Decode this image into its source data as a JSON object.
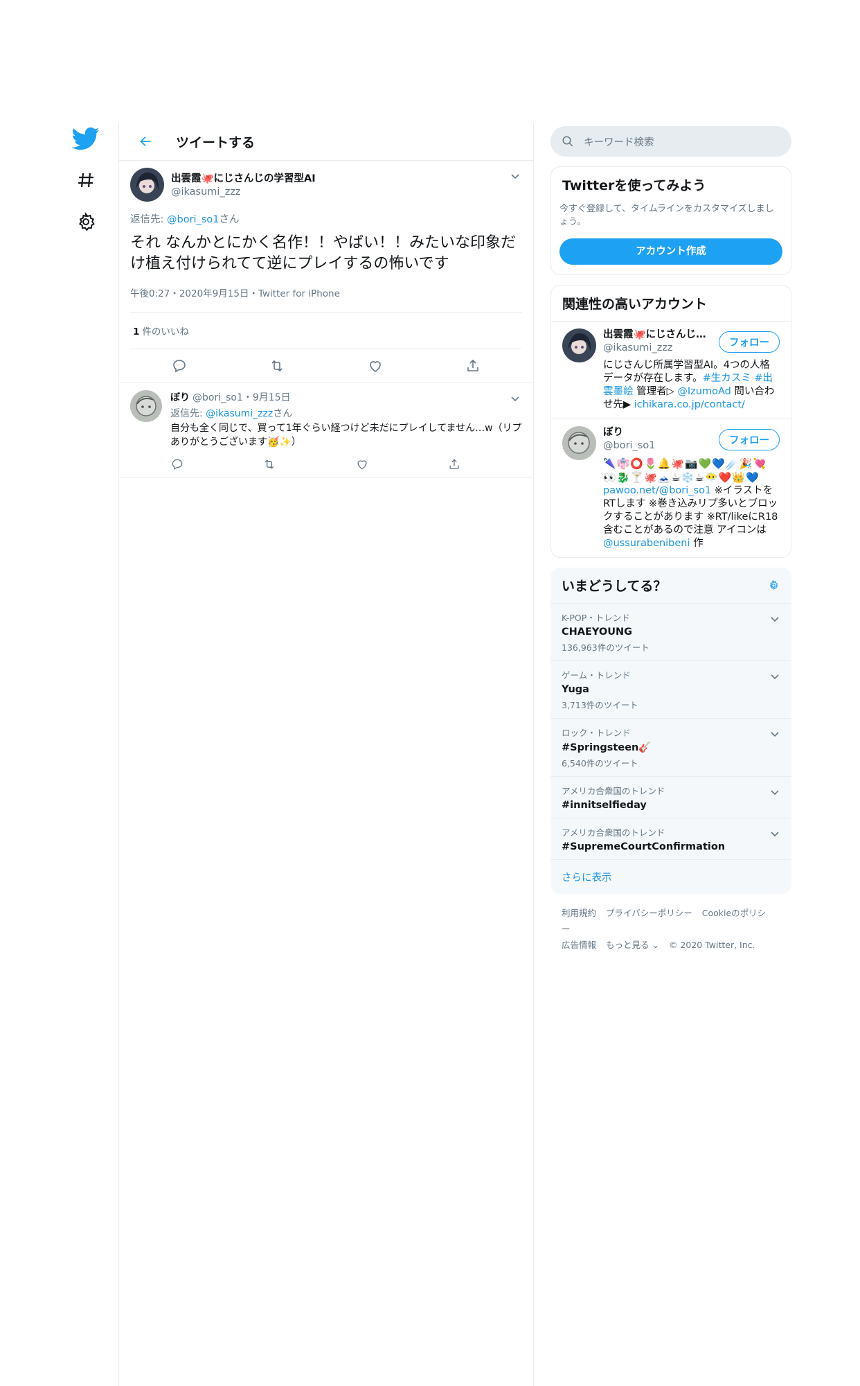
{
  "header": {
    "title": "ツイートする"
  },
  "tweet": {
    "display_name": "出雲霞🐙にじさんじの学習型AI",
    "screen_name": "@ikasumi_zzz",
    "reply_prefix": "返信先: ",
    "reply_to": "@bori_so1",
    "reply_suffix": "さん",
    "text": "それ なんかとにかく名作！！やばい！！みたいな印象だけ植え付けられてて逆にプレイするの怖いです",
    "meta": "午後0:27・2020年9月15日・Twitter for iPhone",
    "like_count": "1",
    "like_label": "件のいいね"
  },
  "reply": {
    "display_name": "ぼり",
    "screen_name": "@bori_so1",
    "date": "・9月15日",
    "reply_prefix": "返信先: ",
    "reply_to": "@ikasumi_zzz",
    "reply_suffix": "さん",
    "text": "自分も全く同じで、買って1年ぐらい経つけど未だにプレイしてません…w（リプありがとうございます🥳✨）"
  },
  "search": {
    "placeholder": "キーワード検索"
  },
  "signup": {
    "title": "Twitterを使ってみよう",
    "desc": "今すぐ登録して、タイムラインをカスタマイズしましょう。",
    "button": "アカウント作成"
  },
  "related": {
    "title": "関連性の高いアカウント",
    "follow_label": "フォロー",
    "accounts": [
      {
        "name": "出雲霞🐙にじさんじの学習型AI",
        "sn": "@ikasumi_zzz",
        "bio_1": "にじさんじ所属学習型AI。4つの人格データが存在します。",
        "bio_tag1": "#生カスミ",
        "bio_tag2": "#出雲墨絵",
        "bio_2": " 管理者▷ ",
        "bio_mention": "@IzumoAd",
        "bio_3": " 問い合わせ先▶ ",
        "bio_link": "ichikara.co.jp/contact/"
      },
      {
        "name": "ぼり",
        "sn": "@bori_so1",
        "emoji": "🌂👘⭕🌷🔔🐙📷💚💙☄️🎉💘👀🐉🍸🐙🗻☕❄️☕😶‍🌫️❤️👑💙",
        "bio_link": "pawoo.net/@bori_so1",
        "bio_1": " ※イラストをRTします ※巻き込みリプ多いとブロックすることがあります ※RT/likeにR18含むことがあるので注意 アイコンは ",
        "bio_mention": "@ussurabenibeni",
        "bio_2": " 作"
      }
    ]
  },
  "trends": {
    "title": "いまどうしてる？",
    "items": [
      {
        "cat": "K-POP・トレンド",
        "name": "CHAEYOUNG",
        "count": "136,963件のツイート"
      },
      {
        "cat": "ゲーム・トレンド",
        "name": "Yuga",
        "count": "3,713件のツイート"
      },
      {
        "cat": "ロック・トレンド",
        "name": "#Springsteen🎸",
        "count": "6,540件のツイート"
      },
      {
        "cat": "アメリカ合衆国のトレンド",
        "name": "#innitselfieday",
        "count": ""
      },
      {
        "cat": "アメリカ合衆国のトレンド",
        "name": "#SupremeCourtConfirmation",
        "count": ""
      }
    ],
    "show_more": "さらに表示"
  },
  "footer": {
    "terms": "利用規約",
    "privacy": "プライバシーポリシー",
    "cookie": "Cookieのポリシー",
    "ads": "広告情報",
    "more": "もっと見る ⌄",
    "copyright": "© 2020 Twitter, Inc."
  },
  "colors": {
    "accent": "#1da1f2",
    "link": "#1b95e0",
    "muted": "#657786",
    "border": "#e6ecf0",
    "trend_bg": "#f5f8fa"
  }
}
